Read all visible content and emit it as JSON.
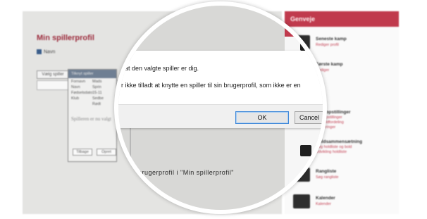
{
  "page": {
    "title": "Min spillerprofil",
    "user_name": "Navn",
    "choose_button": "Vælg spiller",
    "note_text": "Spilleren er nu valgt",
    "lens_caption": "brugerprofil i \"Min spillerprofil\""
  },
  "background_dialog": {
    "header": "Tilknyt spiller",
    "rows": [
      {
        "label": "Fornavn",
        "value": "Mads"
      },
      {
        "label": "Navn",
        "value": "Sprin"
      },
      {
        "label": "Fødselsdato",
        "value": "15-11"
      },
      {
        "label": "Klub",
        "value": "Sedbe"
      },
      {
        "label": "",
        "value": "Rødt"
      }
    ],
    "back_button": "Tilbage",
    "ok_button": "Opret"
  },
  "sidebar": {
    "header": "Genveje",
    "items": [
      {
        "title": "Seneste kamp",
        "sub": "Rediger profil"
      },
      {
        "title": "Første kamp",
        "sub": "Rediger"
      },
      {
        "title": "Holdopstillinger",
        "sub": "Holdopstillinger\nSe holdfordeling\nTurneringer"
      },
      {
        "title": "Holdsammensætning",
        "sub": "Søg holdliste og bold\nUdvikling holdliste"
      },
      {
        "title": "Rangliste",
        "sub": "Søg rangliste"
      },
      {
        "title": "Kalender",
        "sub": "Kalender"
      }
    ]
  },
  "confirm_dialog": {
    "message_line1": "t at den valgte spiller er dig.",
    "message_line2": "r ikke tilladt at knytte en spiller til sin brugerprofil, som ikke er en",
    "ok_label": "OK",
    "cancel_label": "Cancel"
  },
  "colors": {
    "accent": "#c03a4d",
    "ok_focus": "#3b86d8"
  }
}
